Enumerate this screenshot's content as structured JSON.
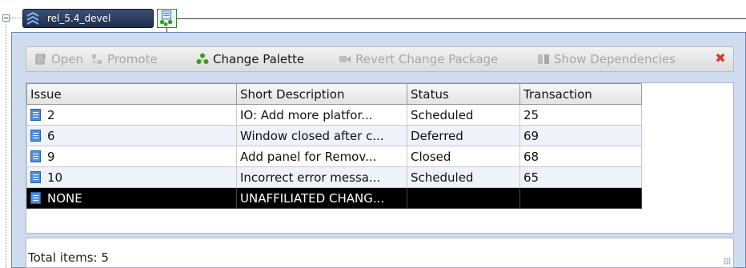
{
  "tree": {
    "node_label": "rel_5.4_devel"
  },
  "toolbar": {
    "items": [
      {
        "label": "Open",
        "enabled": false,
        "icon": "open-doc-icon"
      },
      {
        "label": "Promote",
        "enabled": false,
        "icon": "promote-icon"
      },
      {
        "label": "Change Palette",
        "enabled": true,
        "icon": "change-palette-icon"
      },
      {
        "label": "Revert Change Package",
        "enabled": false,
        "icon": "revert-icon"
      },
      {
        "label": "Show Dependencies",
        "enabled": false,
        "icon": "dependencies-icon"
      }
    ],
    "close_icon": "close-icon"
  },
  "grid": {
    "columns": [
      "Issue",
      "Short Description",
      "Status",
      "Transaction"
    ],
    "rows": [
      {
        "issue": "2",
        "desc": "IO: Add more platfor...",
        "status": "Scheduled",
        "txn": "25"
      },
      {
        "issue": "6",
        "desc": "Window closed after c...",
        "status": "Deferred",
        "txn": "69"
      },
      {
        "issue": "9",
        "desc": "Add panel for Remov...",
        "status": "Closed",
        "txn": "68"
      },
      {
        "issue": "10",
        "desc": "Incorrect error messa...",
        "status": "Scheduled",
        "txn": "65"
      },
      {
        "issue": "NONE",
        "desc": "UNAFFILIATED CHANG...",
        "status": "",
        "txn": ""
      }
    ],
    "selected_row": 4
  },
  "status": {
    "total_text": "Total items: 5"
  },
  "colors": {
    "panel_bg": "#cfdcef",
    "selected_row": "#000000",
    "alt_row": "#eef2fa",
    "close_red": "#d23a2a"
  }
}
